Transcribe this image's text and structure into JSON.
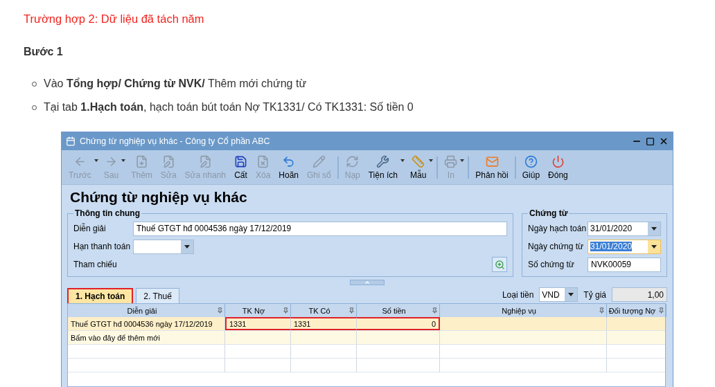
{
  "heading": "Trường hợp 2: Dữ liệu đã tách năm",
  "step": "Bước 1",
  "bullets": [
    "Vào **Tổng hợp/ Chứng từ NVK/** Thêm mới chứng từ",
    "Tại tab **1.Hạch toán**, hạch toán bút toán Nợ TK1331/ Có TK1331: Số tiền 0"
  ],
  "window": {
    "title": "Chứng từ nghiệp vụ khác - Công ty Cổ phần ABC"
  },
  "toolbar": [
    {
      "kind": "button",
      "label": "Trước",
      "disabled": true,
      "dropdown": true
    },
    {
      "kind": "button",
      "label": "Sau",
      "disabled": true,
      "dropdown": true
    },
    {
      "kind": "button",
      "label": "Thêm",
      "disabled": true,
      "dropdown": false
    },
    {
      "kind": "button",
      "label": "Sửa",
      "disabled": true,
      "dropdown": false
    },
    {
      "kind": "button",
      "label": "Sửa nhanh",
      "disabled": true,
      "dropdown": false
    },
    {
      "kind": "button",
      "label": "Cất",
      "disabled": false,
      "dropdown": false
    },
    {
      "kind": "button",
      "label": "Xóa",
      "disabled": true,
      "dropdown": false
    },
    {
      "kind": "button",
      "label": "Hoãn",
      "disabled": false,
      "dropdown": false
    },
    {
      "kind": "button",
      "label": "Ghi sổ",
      "disabled": true,
      "dropdown": false
    },
    {
      "kind": "separator"
    },
    {
      "kind": "button",
      "label": "Nạp",
      "disabled": true,
      "dropdown": false
    },
    {
      "kind": "button",
      "label": "Tiện ích",
      "disabled": false,
      "dropdown": true
    },
    {
      "kind": "button",
      "label": "Mẫu",
      "disabled": false,
      "dropdown": true
    },
    {
      "kind": "separator"
    },
    {
      "kind": "button",
      "label": "In",
      "disabled": true,
      "dropdown": true
    },
    {
      "kind": "separator"
    },
    {
      "kind": "button",
      "label": "Phản hồi",
      "disabled": false,
      "dropdown": false
    },
    {
      "kind": "separator"
    },
    {
      "kind": "button",
      "label": "Giúp",
      "disabled": false,
      "dropdown": false
    },
    {
      "kind": "button",
      "label": "Đóng",
      "disabled": false,
      "dropdown": false
    }
  ],
  "form_title": "Chứng từ nghiệp vụ khác",
  "general": {
    "legend": "Thông tin chung",
    "description_label": "Diễn giải",
    "description": "Thuế GTGT hđ 0004536 ngày 17/12/2019",
    "due_label": "Hạn thanh toán",
    "reference_label": "Tham chiếu"
  },
  "voucher": {
    "legend": "Chứng từ",
    "fields": [
      {
        "label": "Ngày hạch toán",
        "value": "31/01/2020",
        "kind": "dropdown"
      },
      {
        "label": "Ngày chứng từ",
        "value": "31/01/2020",
        "kind": "dropdown",
        "focused": true
      },
      {
        "label": "Số chứng từ",
        "value": "NVK00059",
        "kind": "text"
      }
    ]
  },
  "tabs": [
    {
      "label": "1. Hạch toán",
      "selected": true,
      "highlighted": true
    },
    {
      "label": "2. Thuế",
      "selected": false,
      "highlighted": false
    }
  ],
  "currency_label": "Loại tiền",
  "currency": "VND",
  "rate_label": "Tỷ giá",
  "rate": "1,00",
  "table": {
    "columns": [
      "Diễn giải",
      "TK Nợ",
      "TK Có",
      "Số tiền",
      "Nghiệp vụ",
      "Đối tượng Nợ"
    ],
    "rows": [
      {
        "kind": "data",
        "cells": [
          {
            "text": "Thuế GTGT hđ 0004536 ngày 17/12/2019",
            "highlighted": false
          },
          {
            "text": "1331",
            "highlighted": true
          },
          {
            "text": "1331",
            "highlighted": true
          },
          {
            "text": "0",
            "highlighted": true
          },
          {
            "text": "",
            "highlighted": false
          },
          {
            "text": "",
            "highlighted": false
          }
        ]
      },
      {
        "kind": "new",
        "text": "Bấm vào đây để thêm mới"
      }
    ]
  }
}
